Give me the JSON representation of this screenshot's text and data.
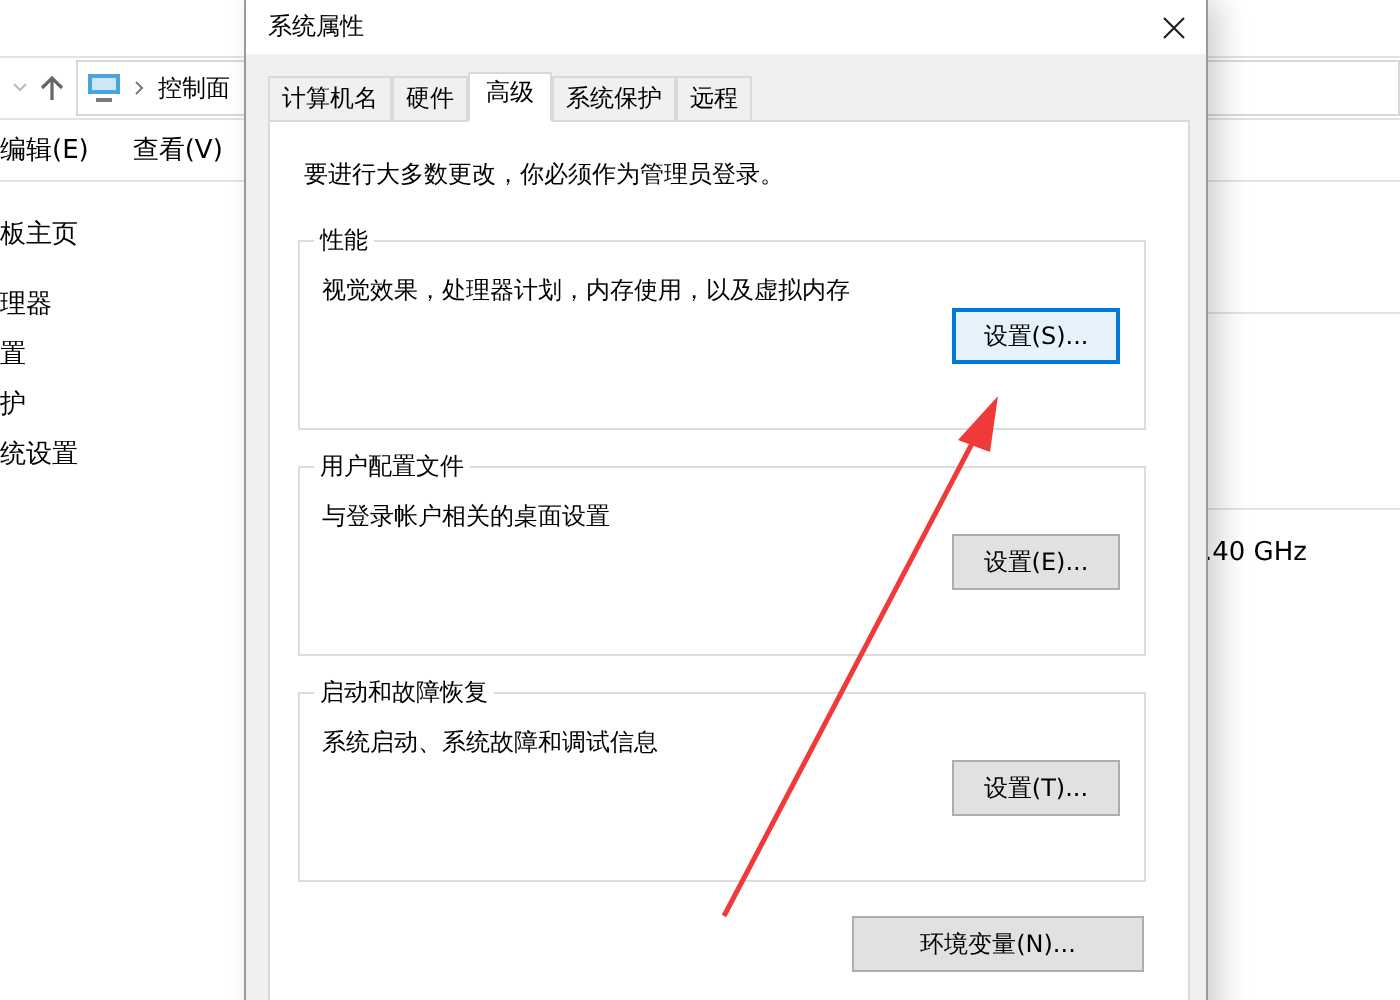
{
  "explorer": {
    "address": "控制面",
    "menu": [
      "编辑(E)",
      "查看(V)"
    ],
    "sidebar": [
      "板主页",
      "理器",
      "置",
      "护",
      "统设置"
    ],
    "detail": ".40 GHz"
  },
  "dialog": {
    "title": "系统属性",
    "tabs": [
      {
        "label": "计算机名",
        "selected": false
      },
      {
        "label": "硬件",
        "selected": false
      },
      {
        "label": "高级",
        "selected": true
      },
      {
        "label": "系统保护",
        "selected": false
      },
      {
        "label": "远程",
        "selected": false
      }
    ],
    "notice": "要进行大多数更改，你必须作为管理员登录。",
    "groups": [
      {
        "title": "性能",
        "description": "视觉效果，处理器计划，内存使用，以及虚拟内存",
        "button": "设置(S)...",
        "focused": true
      },
      {
        "title": "用户配置文件",
        "description": "与登录帐户相关的桌面设置",
        "button": "设置(E)...",
        "focused": false
      },
      {
        "title": "启动和故障恢复",
        "description": "系统启动、系统故障和调试信息",
        "button": "设置(T)...",
        "focused": false
      }
    ],
    "bottom_button": "环境变量(N)..."
  }
}
